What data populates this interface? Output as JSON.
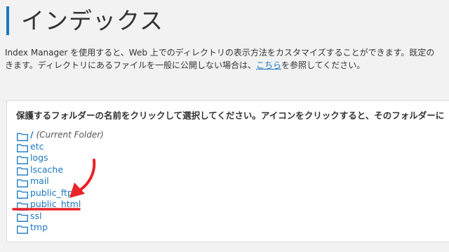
{
  "page": {
    "title": "インデックス"
  },
  "description": {
    "line1": "Index Manager を使用すると、Web 上でのディレクトリの表示方法をカスタマイズすることができます。既定の",
    "line2_before": "きます。ディレクトリにあるファイルを一般に公開しない場合は、",
    "line2_link": "こちら",
    "line2_after": "を参照してください。"
  },
  "panel": {
    "instruction": "保護するフォルダーの名前をクリックして選択してください。アイコンをクリックすると、そのフォルダーに",
    "root": {
      "name": "/",
      "note": "(Current Folder)"
    },
    "folders": [
      {
        "name": "etc"
      },
      {
        "name": "logs"
      },
      {
        "name": "lscache"
      },
      {
        "name": "mail"
      },
      {
        "name": "public_ftp"
      },
      {
        "name": "public_html"
      },
      {
        "name": "ssl"
      },
      {
        "name": "tmp"
      }
    ]
  },
  "colors": {
    "accent": "#1a78c2",
    "annotation": "#e8232a",
    "background": "#f2f2f2"
  },
  "icons": {
    "folder": "folder-icon",
    "annotation_arrow": "red-arrow-annotation"
  }
}
